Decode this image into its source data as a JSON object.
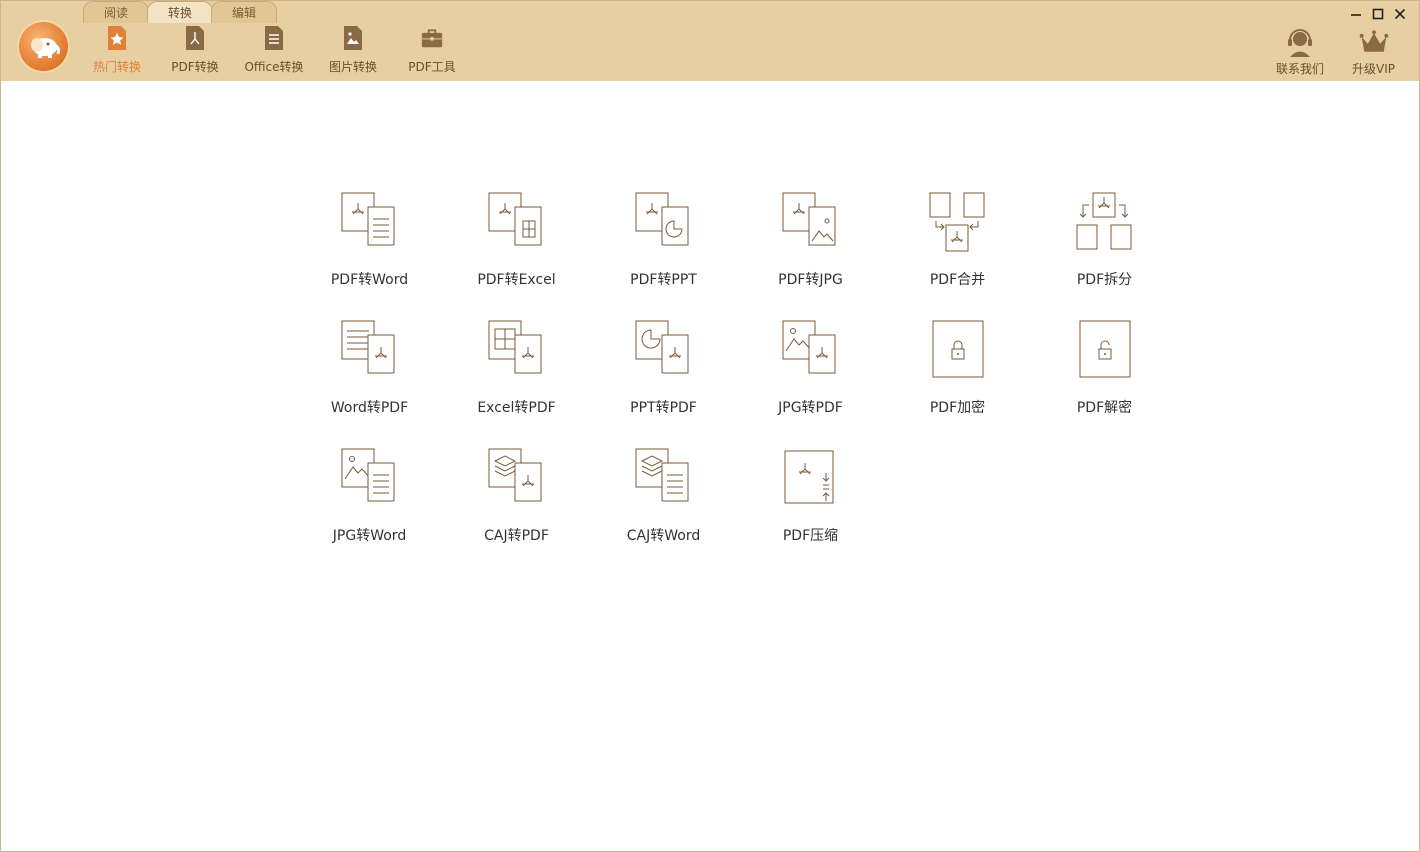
{
  "tabs": [
    {
      "label": "阅读",
      "active": false
    },
    {
      "label": "转换",
      "active": true
    },
    {
      "label": "编辑",
      "active": false
    }
  ],
  "toolbar": [
    {
      "label": "热门转换",
      "icon": "star-doc-icon",
      "active": true
    },
    {
      "label": "PDF转换",
      "icon": "pdf-file-icon",
      "active": false
    },
    {
      "label": "Office转换",
      "icon": "office-doc-icon",
      "active": false
    },
    {
      "label": "图片转换",
      "icon": "image-file-icon",
      "active": false
    },
    {
      "label": "PDF工具",
      "icon": "toolbox-icon",
      "active": false
    }
  ],
  "right_tools": [
    {
      "label": "联系我们",
      "icon": "headset-icon"
    },
    {
      "label": "升级VIP",
      "icon": "crown-icon"
    }
  ],
  "colors": {
    "toolbar_bg": "#e7cfa1",
    "accent": "#e0813a",
    "icon_brown": "#8a6a45",
    "line_icon": "#7a5a3a"
  },
  "tools": [
    {
      "label": "PDF转Word",
      "icon": "pdf-to-word-icon"
    },
    {
      "label": "PDF转Excel",
      "icon": "pdf-to-excel-icon"
    },
    {
      "label": "PDF转PPT",
      "icon": "pdf-to-ppt-icon"
    },
    {
      "label": "PDF转JPG",
      "icon": "pdf-to-jpg-icon"
    },
    {
      "label": "PDF合并",
      "icon": "pdf-merge-icon"
    },
    {
      "label": "PDF拆分",
      "icon": "pdf-split-icon"
    },
    {
      "label": "Word转PDF",
      "icon": "word-to-pdf-icon"
    },
    {
      "label": "Excel转PDF",
      "icon": "excel-to-pdf-icon"
    },
    {
      "label": "PPT转PDF",
      "icon": "ppt-to-pdf-icon"
    },
    {
      "label": "JPG转PDF",
      "icon": "jpg-to-pdf-icon"
    },
    {
      "label": "PDF加密",
      "icon": "pdf-encrypt-icon"
    },
    {
      "label": "PDF解密",
      "icon": "pdf-decrypt-icon"
    },
    {
      "label": "JPG转Word",
      "icon": "jpg-to-word-icon"
    },
    {
      "label": "CAJ转PDF",
      "icon": "caj-to-pdf-icon"
    },
    {
      "label": "CAJ转Word",
      "icon": "caj-to-word-icon"
    },
    {
      "label": "PDF压缩",
      "icon": "pdf-compress-icon"
    }
  ]
}
